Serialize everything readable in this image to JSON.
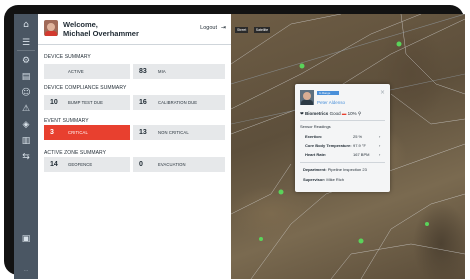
{
  "header": {
    "welcome": "Welcome,",
    "user_name": "Michael Overhammer",
    "logout_label": "Logout"
  },
  "device_summary": {
    "title": "DEVICE SUMMARY",
    "active_label": "ACTIVE",
    "mia_count": "83",
    "mia_label": "MIA"
  },
  "compliance_summary": {
    "title": "DEVICE COMPLIANCE SUMMARY",
    "bump_count": "10",
    "bump_label": "BUMP TEST DUE",
    "calibration_count": "16",
    "calibration_label": "CALIBRATION DUE"
  },
  "event_summary": {
    "title": "EVENT SUMMARY",
    "critical_count": "3",
    "critical_label": "CRITICAL",
    "noncritical_count": "13",
    "noncritical_label": "NON CRITICAL"
  },
  "zone_summary": {
    "title": "ACTIVE ZONE SUMMARY",
    "geofence_count": "14",
    "geofence_label": "GEOFENCE",
    "evacuation_count": "0",
    "evacuation_label": "EVACUATION"
  },
  "map": {
    "btn_map": "Street",
    "btn_sat": "Satellite"
  },
  "popup": {
    "badge": "In Range",
    "name": "Peter Aldenso",
    "biometrics_label": "Biometrics",
    "biometrics_status": "Good",
    "battery": "10%",
    "sensor_title": "Sensor Readings",
    "readings": [
      {
        "label": "Exertion:",
        "value": "25 %"
      },
      {
        "label": "Core Body Temperature:",
        "value": "97.9 °F"
      },
      {
        "label": "Heart Rate:",
        "value": "167 BPM"
      }
    ],
    "department_label": "Department:",
    "department_value": "Pipeline Inspection 23",
    "supervisor_label": "Supervisor:",
    "supervisor_value": "Mike Rich"
  },
  "colors": {
    "critical": "#e8402f",
    "rail": "#4a5663",
    "accent": "#4a90d9"
  }
}
